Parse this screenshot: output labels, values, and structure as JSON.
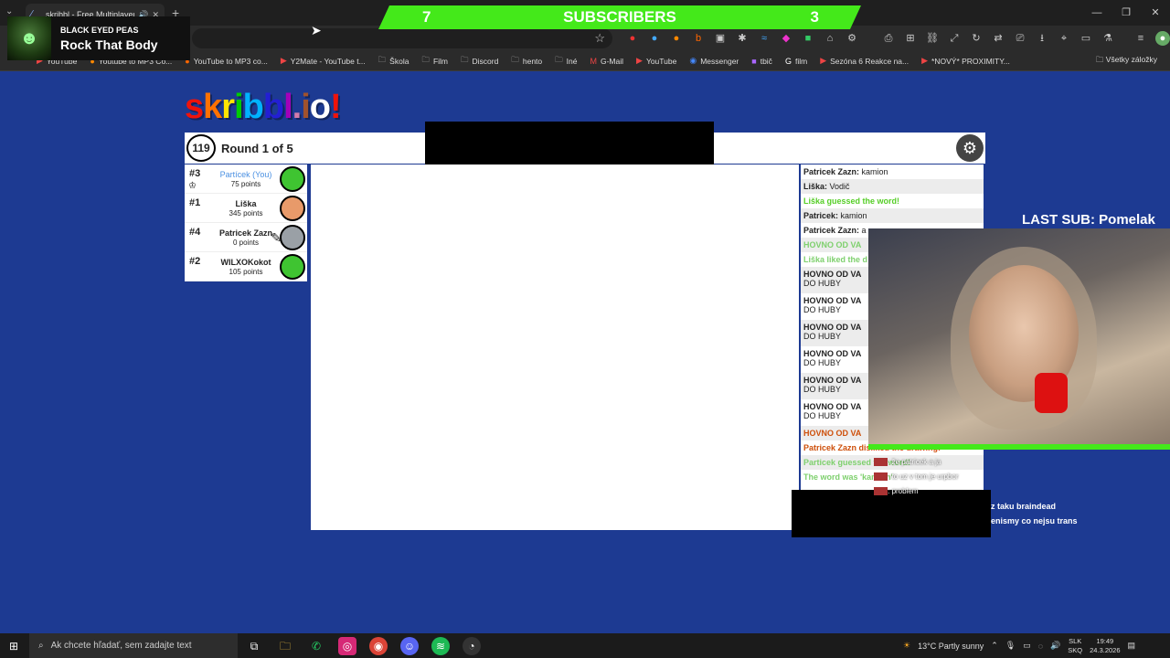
{
  "browser": {
    "tab_title": "skribbl - Free Multiplayer D...",
    "bookmarks": [
      "YouTube",
      "Youtube to MP3 Co...",
      "YouTube to MP3 co...",
      "Y2Mate - YouTube t...",
      "Škola",
      "Film",
      "Discord",
      "hento",
      "Iné",
      "G-Mail",
      "YouTube",
      "Messenger",
      "tbič",
      "film",
      "Sezóna 6 Reakce na...",
      "*NOVÝ* PROXIMITY..."
    ],
    "bookmarks_right": "Všetky záložky"
  },
  "now_playing": {
    "artist": "BLACK EYED PEAS",
    "title": "Rock That Body"
  },
  "sub_bar": {
    "left": "7",
    "center": "SUBSCRIBERS",
    "right": "3"
  },
  "game": {
    "logo": [
      "s",
      "k",
      "r",
      "i",
      "b",
      "b",
      "l",
      ".",
      "i",
      "o",
      "!"
    ],
    "logo_colors": [
      "#ef130b",
      "#ff7100",
      "#ffe400",
      "#00cc00",
      "#00b2ff",
      "#231fd3",
      "#a300ba",
      "#d37caa",
      "#a0522d",
      "#ffffff",
      "#ef130b"
    ],
    "timer": "119",
    "round_label": "Round 1 of 5",
    "players": [
      {
        "rank": "#3",
        "name": "Partícek (You)",
        "points": "75 points",
        "you": true,
        "avatar_color": "#3fc431"
      },
      {
        "rank": "#1",
        "name": "Liška",
        "points": "345 points",
        "you": false,
        "avatar_color": "#e89a6a"
      },
      {
        "rank": "#4",
        "name": "Patricek Zazn",
        "points": "0 points",
        "you": false,
        "avatar_color": "#9aa0a6"
      },
      {
        "rank": "#2",
        "name": "WILXOKokot",
        "points": "105 points",
        "you": false,
        "avatar_color": "#3fc431"
      }
    ],
    "chat": [
      {
        "who": "Patricek Zazn:",
        "text": "kamion",
        "style": "normal"
      },
      {
        "who": "Liška:",
        "text": "Vodič",
        "style": "normal"
      },
      {
        "who": "",
        "text": "Liška guessed the word!",
        "style": "green"
      },
      {
        "who": "Patricek:",
        "text": "kamion",
        "style": "normal"
      },
      {
        "who": "Patricek Zazn:",
        "text": "a",
        "style": "normal"
      },
      {
        "who": "",
        "text": "HOVNO OD VA",
        "style": "lgreen"
      },
      {
        "who": "",
        "text": "Liška liked the d",
        "style": "lgreen"
      },
      {
        "who": "HOVNO OD VA",
        "text": "DO HUBY",
        "style": "tall"
      },
      {
        "who": "HOVNO OD VA",
        "text": "DO HUBY",
        "style": "tall"
      },
      {
        "who": "HOVNO OD VA",
        "text": "DO HUBY",
        "style": "tall"
      },
      {
        "who": "HOVNO OD VA",
        "text": "DO HUBY",
        "style": "tall"
      },
      {
        "who": "HOVNO OD VA",
        "text": "DO HUBY",
        "style": "tall"
      },
      {
        "who": "HOVNO OD VA",
        "text": "DO HUBY",
        "style": "tall"
      },
      {
        "who": "",
        "text": "HOVNO OD VA",
        "style": "orange"
      },
      {
        "who": "",
        "text": "Patricek Zazn disliked the drawing!",
        "style": "orange"
      },
      {
        "who": "",
        "text": "Particek guessed the word!",
        "style": "lgreen"
      },
      {
        "who": "",
        "text": "The word was 'kamion'",
        "style": "lgreen"
      }
    ]
  },
  "stream": {
    "last_sub": "LAST SUB: Pomelak",
    "overlay_chat": [
      ": že patricek a ja",
      ": to uz v tom je urpbor",
      ": problem"
    ],
    "overlay_chat2": [
      "z taku braindead",
      "enismy co nejsu trans"
    ]
  },
  "taskbar": {
    "search_placeholder": "Ak chcete hľadať, sem zadajte text",
    "weather": "13°C  Partly sunny",
    "lang": "SLK\nSKQ",
    "time": "19:49",
    "date": "24.3.2026"
  }
}
